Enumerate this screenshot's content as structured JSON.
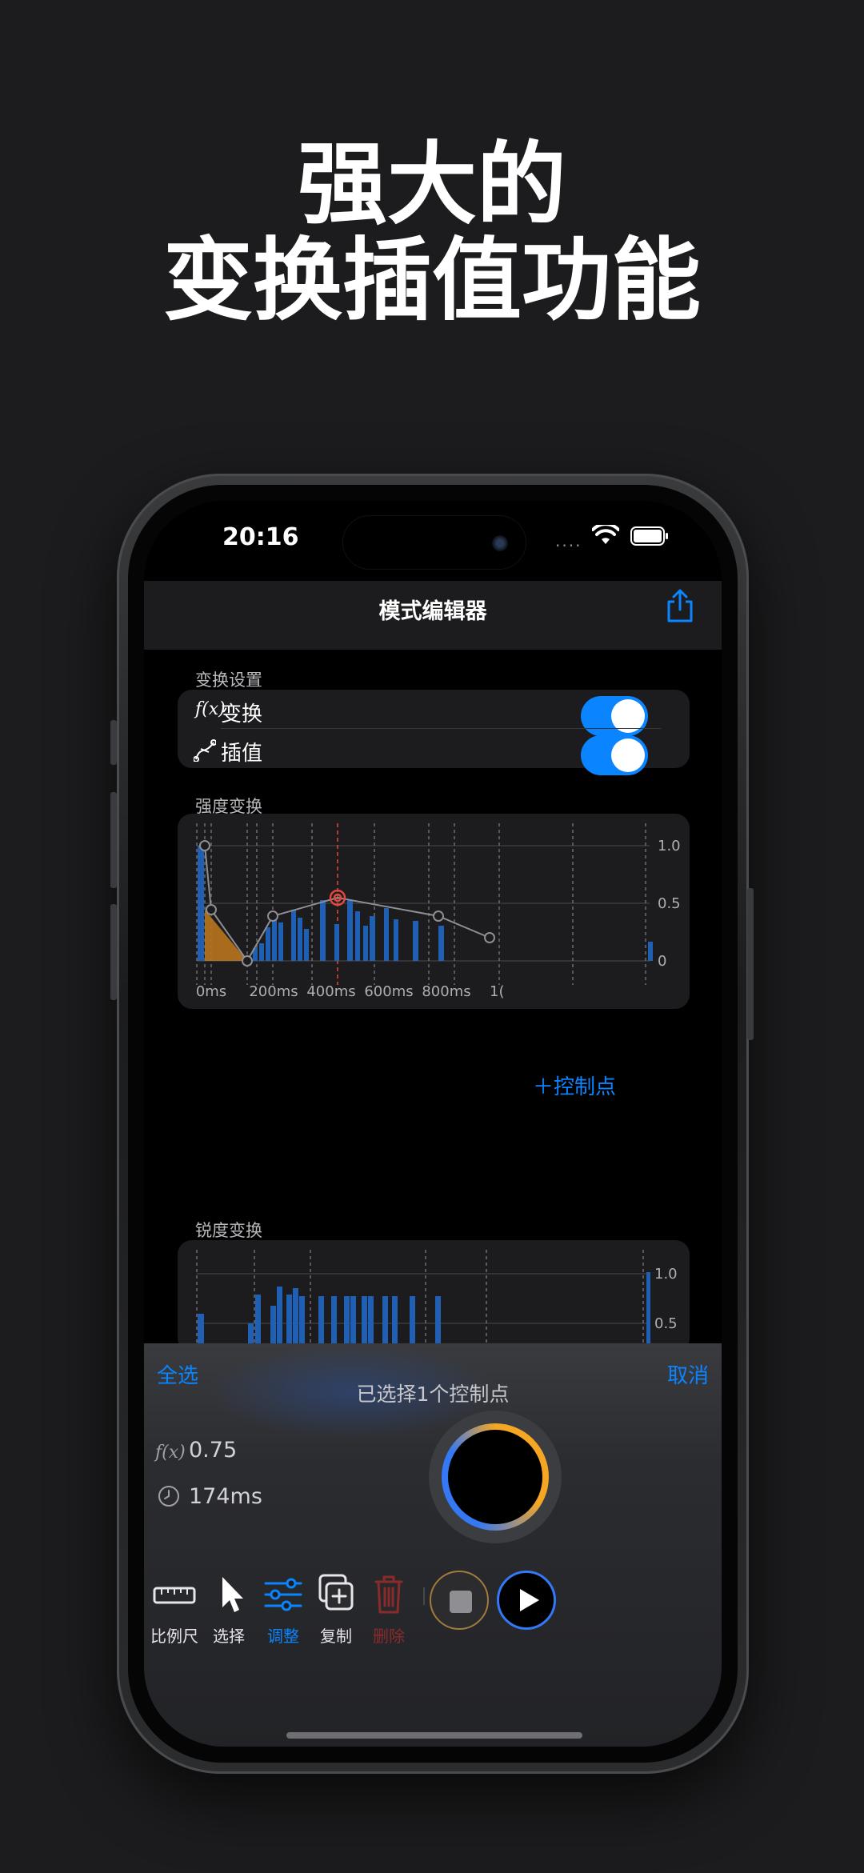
{
  "headline": {
    "line1": "强大的",
    "line2": "变换插值功能"
  },
  "status_bar": {
    "time": "20:16"
  },
  "nav": {
    "title": "模式编辑器",
    "share_icon": "share-icon"
  },
  "transform_settings": {
    "section_label": "变换设置",
    "rows": [
      {
        "icon_text": "f(x)",
        "label": "变换",
        "on": true
      },
      {
        "icon_name": "curve-icon",
        "label": "插值",
        "on": true
      }
    ]
  },
  "intensity": {
    "section_label": "强度变换",
    "x_ticks": [
      "0ms",
      "200ms",
      "400ms",
      "600ms",
      "800ms",
      "1("
    ],
    "y_ticks": [
      "1.0",
      "0.5",
      "0"
    ]
  },
  "add_control_point": "＋控制点",
  "sharpness": {
    "section_label": "锐度变换",
    "y_ticks": [
      "1.0",
      "0.5"
    ]
  },
  "sheet": {
    "select_all": "全选",
    "cancel": "取消",
    "info": "已选择1个控制点",
    "fx_icon": "f(x)",
    "fx_value": "0.75",
    "time_value": "174ms"
  },
  "toolbar": {
    "items": [
      {
        "label": "比例尺",
        "icon": "ruler-icon"
      },
      {
        "label": "选择",
        "icon": "cursor-icon"
      },
      {
        "label": "调整",
        "icon": "sliders-icon",
        "active": true
      },
      {
        "label": "复制",
        "icon": "duplicate-icon"
      },
      {
        "label": "删除",
        "icon": "trash-icon",
        "danger": true
      }
    ]
  },
  "colors": {
    "accent": "#0a84ff",
    "bar_blue": "#1f5fb4",
    "fill_orange": "#b8761c",
    "selected_red": "#e0483e",
    "background": "#1c1c1e"
  }
}
